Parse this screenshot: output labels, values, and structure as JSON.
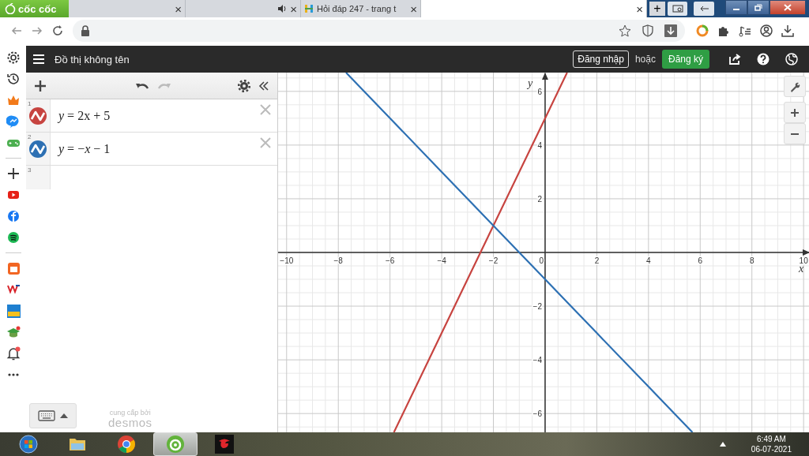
{
  "browser": {
    "brand": "cốc cốc",
    "tabs": [
      {
        "close": "×",
        "audio": false,
        "selected": false
      },
      {
        "close": "×",
        "audio": true,
        "selected": false
      },
      {
        "title": "Hỏi đáp 247 - trang t",
        "close": "×",
        "audio": false,
        "selected": false
      },
      {
        "close": "×",
        "audio": false,
        "selected": true
      }
    ],
    "new_tab": "+"
  },
  "app": {
    "title": "Đồ thị không tên",
    "login": "Đăng nhập",
    "or": "hoặc",
    "signup": "Đăng ký"
  },
  "expressions": [
    {
      "number": "1",
      "latex": "*y* = 2x + 5",
      "color": "#c74440"
    },
    {
      "number": "2",
      "latex": "*y* = −*x* − 1",
      "color": "#2d70b3"
    },
    {
      "number": "3"
    }
  ],
  "branding": {
    "caption": "cung cấp bởi",
    "logo": "desmos"
  },
  "graph": {
    "chart_data": {
      "type": "line",
      "xlabel": "x",
      "ylabel": "y",
      "x": [
        -7.7,
        -5.85,
        -4,
        -2,
        0,
        0.85,
        2,
        4,
        5.7
      ],
      "series": [
        {
          "color": "#c74440",
          "values": [
            null,
            -6.7,
            -3,
            1,
            5,
            6.7,
            null,
            null,
            null
          ]
        },
        {
          "color": "#2d70b3",
          "values": [
            6.7,
            4.85,
            3,
            1,
            -1,
            -1.85,
            -3,
            -5,
            -6.7
          ]
        }
      ],
      "grid": true,
      "xlim": [
        -10.33,
        10.24
      ],
      "ylim": [
        -6.7,
        6.7
      ],
      "xticks": [
        -10,
        -8,
        -6,
        -4,
        -2,
        0,
        2,
        4,
        6,
        8,
        10
      ],
      "yticks": [
        -6,
        -4,
        -2,
        2,
        4,
        6
      ]
    }
  },
  "taskbar": {
    "apps": [
      {
        "kind": "start",
        "selected": false
      },
      {
        "kind": "folder",
        "selected": false
      },
      {
        "kind": "chrome",
        "selected": false
      },
      {
        "kind": "coccoc",
        "selected": true
      },
      {
        "kind": "game",
        "selected": false
      }
    ],
    "time": "6:49 AM",
    "date": "06-07-2021"
  }
}
